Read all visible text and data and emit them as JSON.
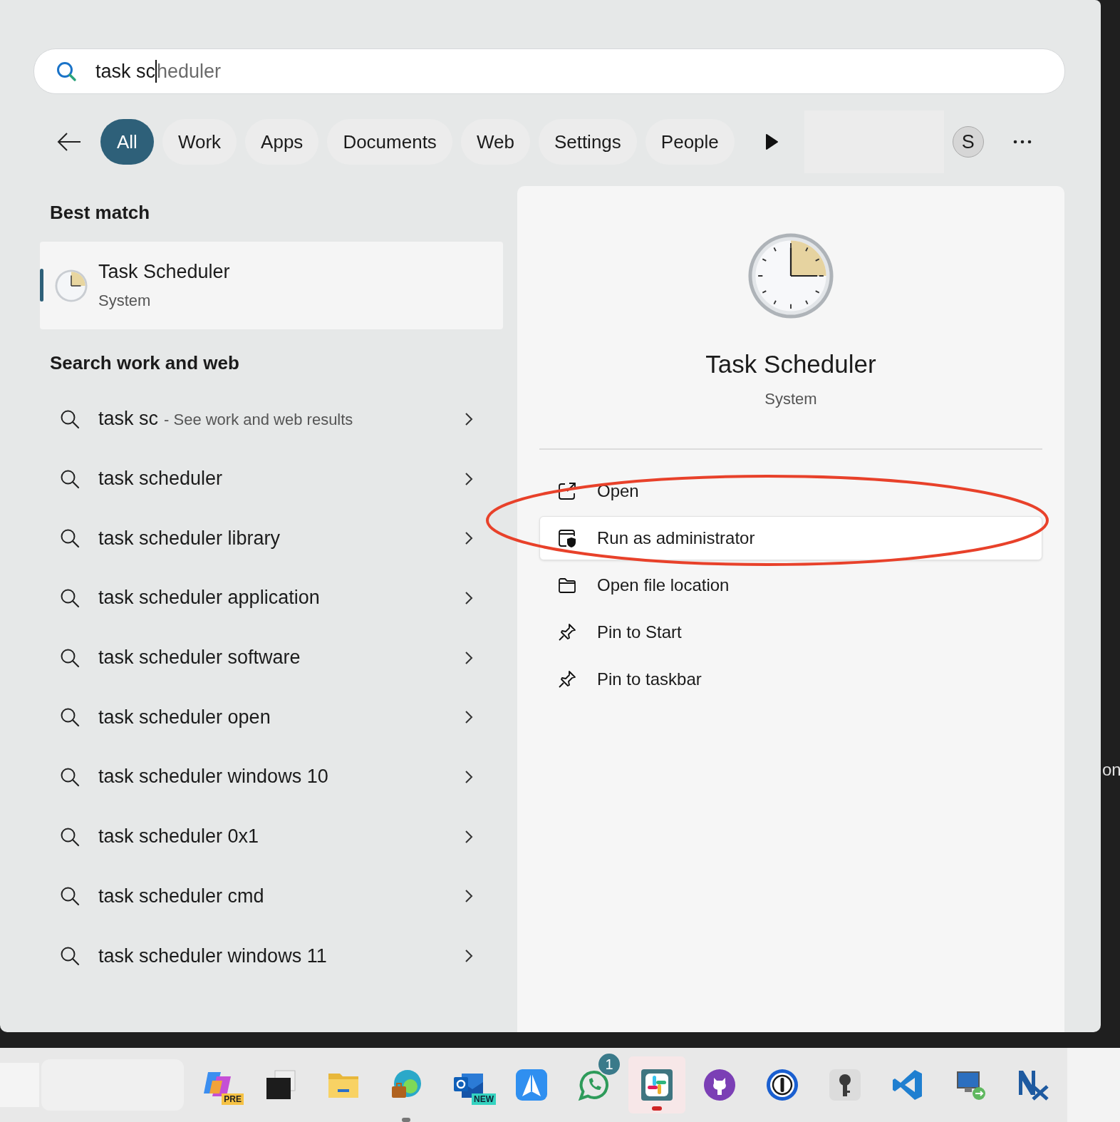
{
  "search": {
    "value": "task sc",
    "completion": "heduler"
  },
  "filters": [
    {
      "label": "All",
      "selected": true
    },
    {
      "label": "Work",
      "selected": false
    },
    {
      "label": "Apps",
      "selected": false
    },
    {
      "label": "Documents",
      "selected": false
    },
    {
      "label": "Web",
      "selected": false
    },
    {
      "label": "Settings",
      "selected": false
    },
    {
      "label": "People",
      "selected": false
    }
  ],
  "account": {
    "initial": "S"
  },
  "best_match": {
    "heading": "Best match",
    "title": "Task Scheduler",
    "subtitle": "System",
    "selected": true
  },
  "web_search": {
    "heading": "Search work and web",
    "items": [
      {
        "query": "task sc",
        "hint": "- See work and web results"
      },
      {
        "query": "task scheduler"
      },
      {
        "query": "task scheduler library"
      },
      {
        "query": "task scheduler application"
      },
      {
        "query": "task scheduler software"
      },
      {
        "query": "task scheduler open"
      },
      {
        "query": "task scheduler windows 10"
      },
      {
        "query": "task scheduler 0x1"
      },
      {
        "query": "task scheduler cmd"
      },
      {
        "query": "task scheduler windows 11"
      }
    ]
  },
  "details": {
    "title": "Task Scheduler",
    "subtitle": "System",
    "actions": [
      {
        "label": "Open",
        "kind": "open",
        "selected": false
      },
      {
        "label": "Run as administrator",
        "kind": "admin",
        "selected": true
      },
      {
        "label": "Open file location",
        "kind": "folder",
        "selected": false
      },
      {
        "label": "Pin to Start",
        "kind": "pin",
        "selected": false
      },
      {
        "label": "Pin to taskbar",
        "kind": "pin",
        "selected": false
      }
    ]
  },
  "background_text": "on",
  "taskbar": {
    "apps": [
      {
        "kind": "copilot",
        "badge": "PRE",
        "selected": false,
        "running": false
      },
      {
        "kind": "windows",
        "selected": false,
        "running": false
      },
      {
        "kind": "explorer",
        "selected": false,
        "running": false
      },
      {
        "kind": "edge",
        "selected": false,
        "running": true
      },
      {
        "kind": "outlook",
        "badge": "NEW",
        "selected": false,
        "running": false
      },
      {
        "kind": "paperplane",
        "selected": false,
        "running": false
      },
      {
        "kind": "whatsapp",
        "badge": "1",
        "selected": false,
        "running": false
      },
      {
        "kind": "slack",
        "selected": true,
        "running": true
      },
      {
        "kind": "github",
        "selected": false,
        "running": false
      },
      {
        "kind": "keyhole",
        "selected": false,
        "running": false
      },
      {
        "kind": "key",
        "selected": false,
        "running": false
      },
      {
        "kind": "vscode",
        "selected": false,
        "running": false
      },
      {
        "kind": "remote",
        "selected": false,
        "running": false
      },
      {
        "kind": "nx",
        "selected": false,
        "running": false
      }
    ]
  }
}
